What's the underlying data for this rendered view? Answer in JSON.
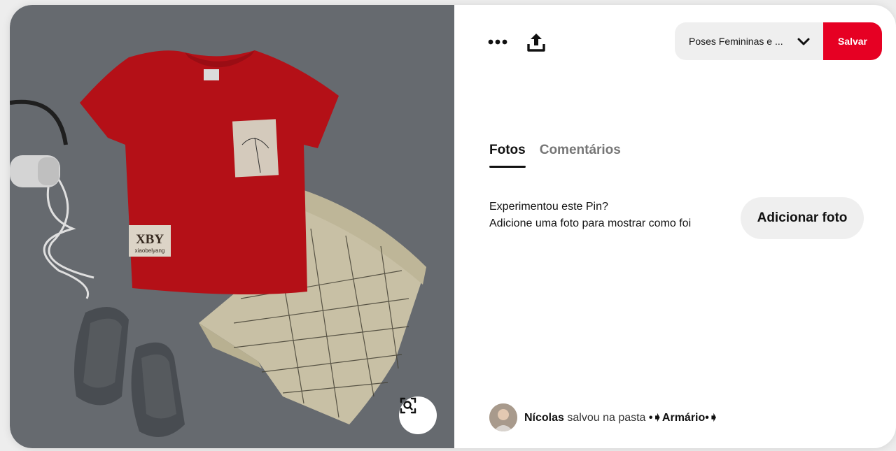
{
  "pin": {
    "image_alt": "Conjunto infantil camiseta vermelha e bermuda xadrez",
    "shirt_tag_brand": "XBY",
    "shirt_tag_sub": "xiaobelyang"
  },
  "toolbar": {
    "more_icon": "ellipsis-icon",
    "share_icon": "share-upload-icon",
    "board_name": "Poses Femininas e ...",
    "chevron_icon": "chevron-down-icon",
    "save_label": "Salvar",
    "save_color": "#e60023"
  },
  "tabs": [
    {
      "label": "Fotos",
      "active": true
    },
    {
      "label": "Comentários",
      "active": false
    }
  ],
  "tried": {
    "line1": "Experimentou este Pin?",
    "line2": "Adicione uma foto para mostrar como foi",
    "button_label": "Adicionar foto"
  },
  "saver": {
    "name": "Nícolas",
    "action": "salvou na pasta",
    "board": "•➧Armário•➧"
  },
  "lens": {
    "icon": "visual-search-icon"
  }
}
